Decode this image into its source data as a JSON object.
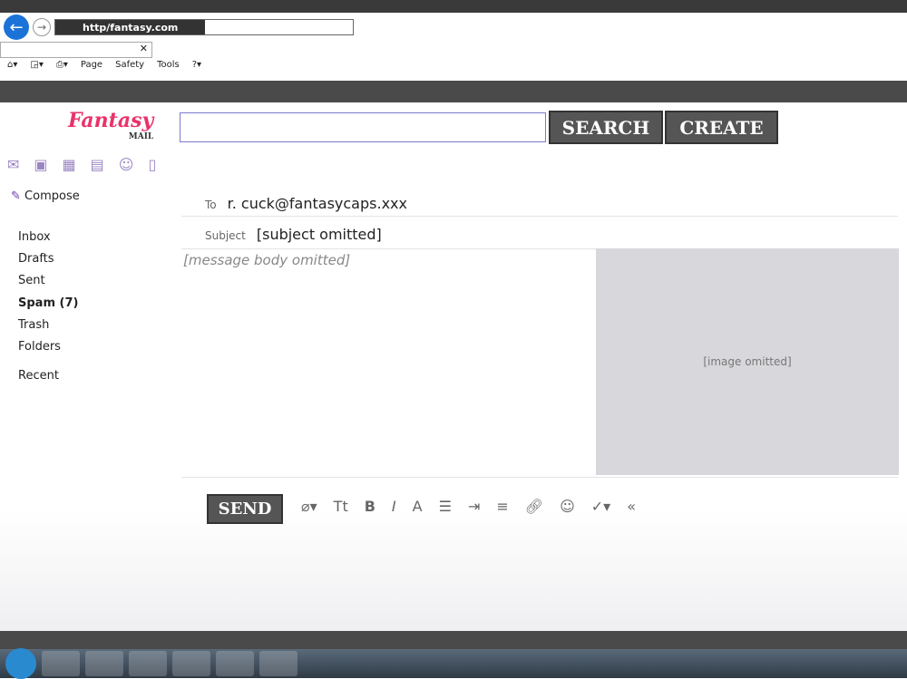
{
  "browser": {
    "url": "http/fantasy.com",
    "menu": [
      "Page",
      "Safety",
      "Tools"
    ]
  },
  "app": {
    "logo": "Fantasy",
    "logo_sub": "MAIL",
    "search_label": "SEARCH",
    "create_label": "CREATE"
  },
  "sidebar": {
    "compose": "Compose",
    "items": [
      "Inbox",
      "Drafts",
      "Sent",
      "Spam (7)",
      "Trash",
      "Folders",
      "Recent"
    ]
  },
  "message": {
    "to_label": "To",
    "to": "r. cuck@fantasycaps.xxx",
    "subject_label": "Subject",
    "subject": "[subject omitted]",
    "body": "[message body omitted]",
    "image": "[image omitted]"
  },
  "compose_toolbar": {
    "send": "SEND"
  }
}
